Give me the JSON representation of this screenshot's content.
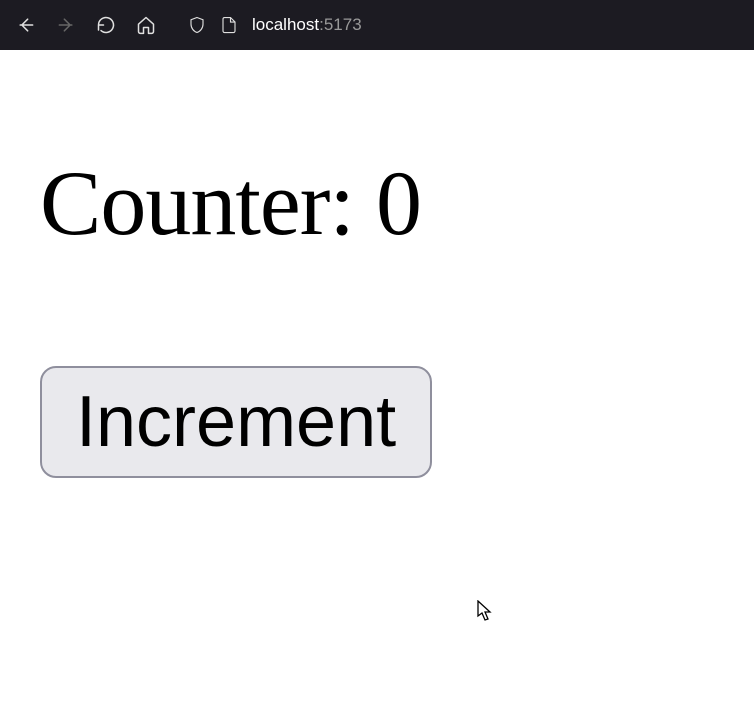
{
  "browser": {
    "url_host": "localhost",
    "url_port": ":5173"
  },
  "page": {
    "counter_label": "Counter: ",
    "counter_value": "0",
    "increment_label": "Increment"
  }
}
